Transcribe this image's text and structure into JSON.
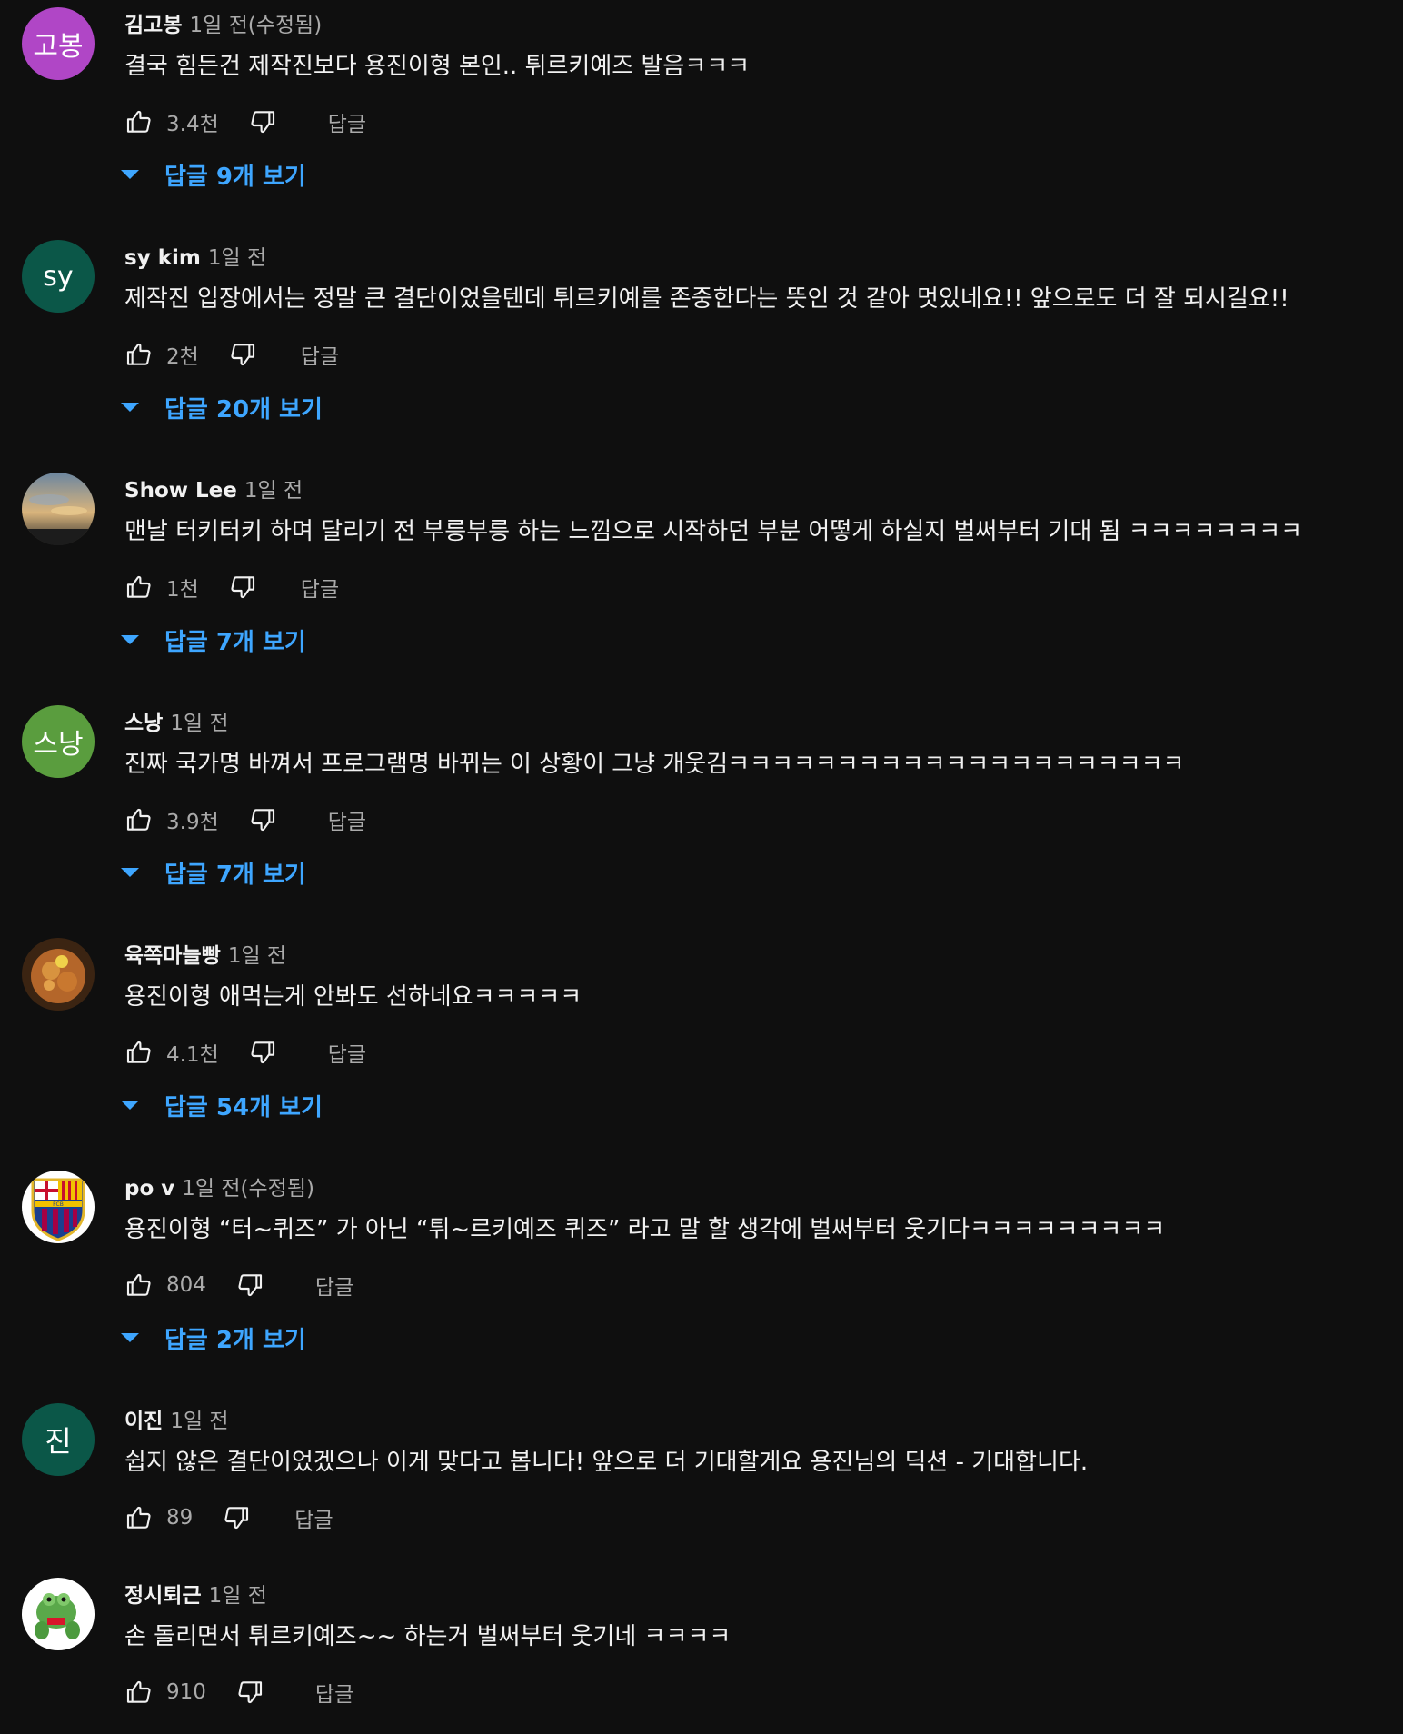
{
  "ui": {
    "link_color": "#3ea6ff"
  },
  "comments": [
    {
      "author": "김고봉",
      "time": "1일 전(수정됨)",
      "text": "결국 힘든건 제작진보다 용진이형 본인.. 튀르키예즈 발음ㅋㅋㅋ",
      "likes": "3.4천",
      "reply_label": "답글",
      "replies_label": "답글 9개 보기",
      "avatar": {
        "kind": "initials",
        "initials": "고봉",
        "color": "#b046c6"
      }
    },
    {
      "author": "sy kim",
      "time": "1일 전",
      "text": "제작진 입장에서는 정말 큰 결단이었을텐데 튀르키예를 존중한다는 뜻인 것 같아 멋있네요!! 앞으로도 더 잘 되시길요!!",
      "likes": "2천",
      "reply_label": "답글",
      "replies_label": "답글 20개 보기",
      "avatar": {
        "kind": "initials",
        "initials": "sy",
        "color": "#0b5748"
      }
    },
    {
      "author": "Show Lee",
      "time": "1일 전",
      "text": "맨날 터키터키 하며 달리기 전 부릉부릉 하는 느낌으로  시작하던 부분 어떻게 하실지 벌써부터 기대 됨 ㅋㅋㅋㅋㅋㅋㅋㅋ",
      "likes": "1천",
      "reply_label": "답글",
      "replies_label": "답글 7개 보기",
      "avatar": {
        "kind": "photo",
        "icon": "sunset-photo-avatar"
      }
    },
    {
      "author": "스낭",
      "time": "1일 전",
      "text": "진짜 국가명 바껴서 프로그램명 바뀌는 이 상황이 그냥 개웃김ㅋㅋㅋㅋㅋㅋㅋㅋㅋㅋㅋㅋㅋㅋㅋㅋㅋㅋㅋㅋㅋ",
      "likes": "3.9천",
      "reply_label": "답글",
      "replies_label": "답글 7개 보기",
      "avatar": {
        "kind": "initials",
        "initials": "스낭",
        "color": "#5a9d3e"
      }
    },
    {
      "author": "육쪽마늘빵",
      "time": "1일 전",
      "text": "용진이형 애먹는게 안봐도 선하네요ㅋㅋㅋㅋㅋ",
      "likes": "4.1천",
      "reply_label": "답글",
      "replies_label": "답글 54개 보기",
      "avatar": {
        "kind": "photo",
        "icon": "food-photo-avatar"
      }
    },
    {
      "author": "po v",
      "time": "1일 전(수정됨)",
      "text": "용진이형 “터~퀴즈” 가 아닌 “튀~르키예즈 퀴즈” 라고 말 할 생각에 벌써부터 웃기다ㅋㅋㅋㅋㅋㅋㅋㅋㅋ",
      "likes": "804",
      "reply_label": "답글",
      "replies_label": "답글 2개 보기",
      "avatar": {
        "kind": "photo",
        "icon": "club-crest-avatar",
        "crest_text": "FCB"
      }
    },
    {
      "author": "이진",
      "time": "1일 전",
      "text": "쉽지 않은 결단이었겠으나 이게 맞다고 봅니다! 앞으로 더 기대할게요 용진님의 딕션 - 기대합니다.",
      "likes": "89",
      "reply_label": "답글",
      "replies_label": null,
      "avatar": {
        "kind": "initials",
        "initials": "진",
        "color": "#0b5748"
      }
    },
    {
      "author": "정시퇴근",
      "time": "1일 전",
      "text": "손 돌리면서 튀르키예즈~~ 하는거 벌써부터 웃기네 ㅋㅋㅋㅋ",
      "likes": "910",
      "reply_label": "답글",
      "replies_label": null,
      "avatar": {
        "kind": "photo",
        "icon": "frog-photo-avatar"
      }
    }
  ]
}
